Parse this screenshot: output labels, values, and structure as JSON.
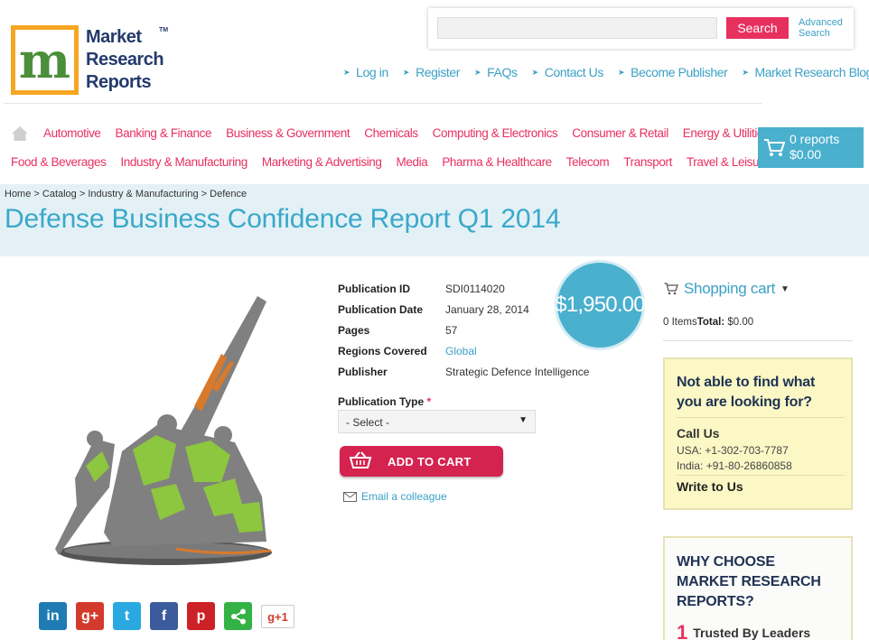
{
  "header": {
    "logo_text_1": "Market",
    "logo_text_2": "Research",
    "logo_text_3": "Reports",
    "logo_tm": "TM",
    "search": {
      "placeholder": "",
      "value": "",
      "button_label": "Search",
      "advanced_1": "Advanced",
      "advanced_2": "Search"
    },
    "links": [
      "Log in",
      "Register",
      "FAQs",
      "Contact Us",
      "Become Publisher",
      "Market Research Blog"
    ]
  },
  "nav": {
    "row1": [
      "Automotive",
      "Banking & Finance",
      "Business & Government",
      "Chemicals",
      "Computing & Electronics",
      "Consumer & Retail",
      "Energy & Utilities"
    ],
    "row2": [
      "Food & Beverages",
      "Industry & Manufacturing",
      "Marketing & Advertising",
      "Media",
      "Pharma & Healthcare",
      "Telecom",
      "Transport",
      "Travel & Leisure"
    ]
  },
  "cart": {
    "reports": "0 reports",
    "total": "$0.00"
  },
  "breadcrumb": "Home > Catalog > Industry & Manufacturing > Defence",
  "title": "Defense Business Confidence Report Q1 2014",
  "product": {
    "price": "$1,950.00",
    "details": [
      {
        "label": "Publication ID",
        "value": "SDI0114020",
        "link": false
      },
      {
        "label": "Publication Date",
        "value": "January 28, 2014",
        "link": false
      },
      {
        "label": "Pages",
        "value": "57",
        "link": false
      },
      {
        "label": "Regions Covered",
        "value": "Global",
        "link": true
      },
      {
        "label": "Publisher",
        "value": "Strategic Defence Intelligence",
        "link": false
      }
    ],
    "pub_type_label": "Publication Type",
    "pub_type_required": "*",
    "pub_type_selected": "- Select -",
    "add_to_cart": "ADD TO CART",
    "email_colleague": "Email a colleague"
  },
  "social": [
    "in",
    "g+",
    "t",
    "f",
    "p",
    "share",
    "g+1"
  ],
  "sidebar": {
    "shopping_cart": "Shopping cart",
    "items": "0 Items",
    "total_label": "Total:",
    "total_value": " $0.00",
    "help": {
      "question_1": "Not able to find what",
      "question_2": "you are looking for?",
      "call_us": "Call Us",
      "usa": "USA: +1-302-703-7787",
      "india": "India: +91-80-26860858",
      "write": "Write to Us"
    },
    "why": {
      "title_1": "WHY CHOOSE",
      "title_2": "MARKET RESEARCH",
      "title_3": "REPORTS?",
      "item_num": "1",
      "item_label": "Trusted By Leaders"
    }
  },
  "colors": {
    "accent_pink": "#e8305f",
    "accent_blue": "#3aa0c6",
    "cart_blue": "#4ab0ce"
  }
}
